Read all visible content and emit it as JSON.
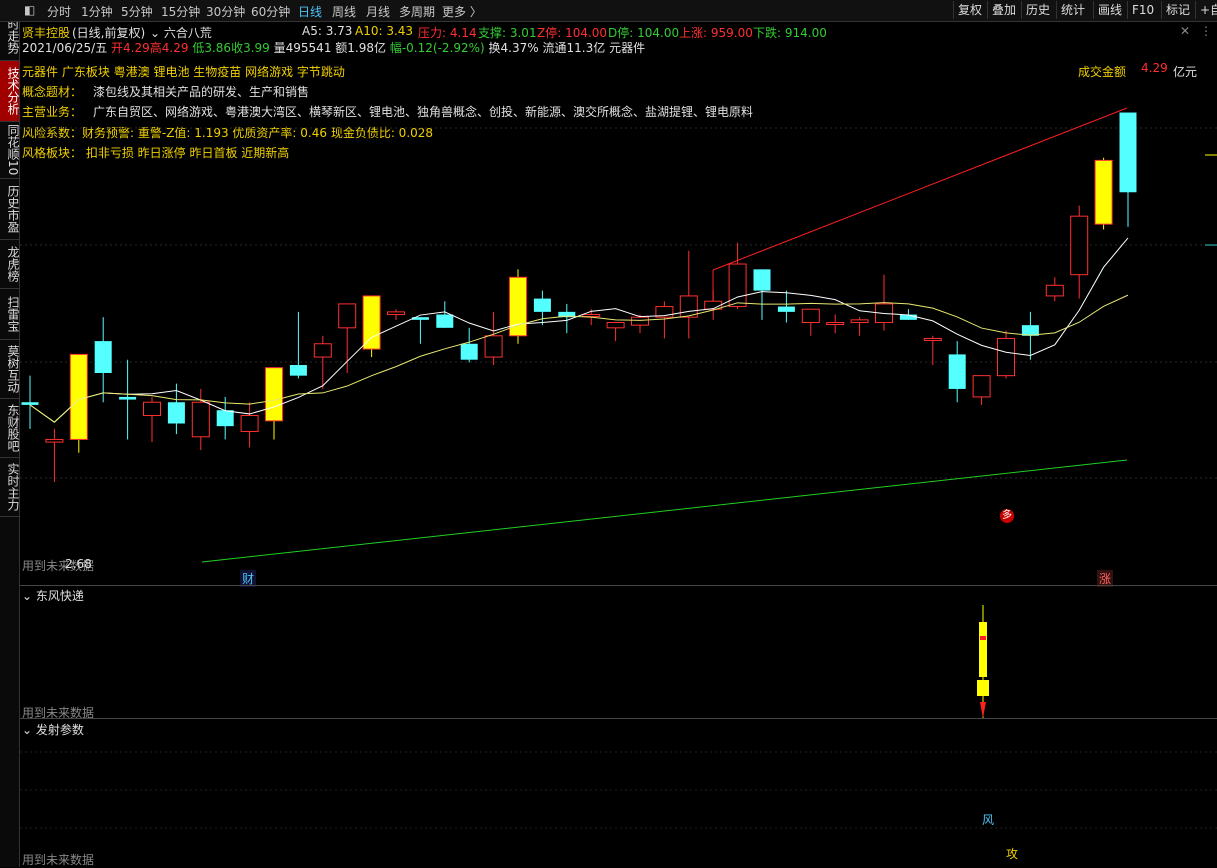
{
  "toolbar": {
    "periods": [
      "分时",
      "1分钟",
      "5分钟",
      "15分钟",
      "30分钟",
      "60分钟",
      "日线",
      "周线",
      "月线",
      "多周期",
      "更多 〉"
    ],
    "active_period": "日线",
    "right_buttons": [
      "复权",
      "叠加",
      "历史",
      "统计",
      "画线",
      "F10",
      "标记",
      "+自"
    ]
  },
  "side_tabs": [
    "分时走势",
    "技术分析",
    "同花顺10",
    "历史市盈",
    "龙虎榜",
    "扫雷宝",
    "莫树互动",
    "东财股吧",
    "实时主力"
  ],
  "active_side_tab": "技术分析",
  "header": {
    "stock_name": "贤丰控股",
    "mode": "(日线,前复权)",
    "indicator": "六合八荒",
    "a5": "A5: 3.73",
    "a10": "A10: 3.43",
    "pressure": "压力: 4.14",
    "support": "支撑: 3.01",
    "z_stop": "Z停: 104.00",
    "d_stop": "D停: 104.00",
    "up": "上涨: 959.00",
    "down": "下跌: 914.00"
  },
  "quote": {
    "date": "2021/06/25/五",
    "open": "开4.29",
    "high": "高4.29",
    "low": "低3.86",
    "close": "收3.99",
    "volume": "量495541",
    "amount": "额1.98亿",
    "change": "幅-0.12(-2.92%)",
    "turnover": "换4.37%",
    "float": "流通11.3亿",
    "sector": "元器件"
  },
  "info": {
    "tags": "元器件 广东板块 粤港澳 锂电池 生物疫苗 网络游戏 字节跳动",
    "concept_label": "概念题材：",
    "concept_value": "漆包线及其相关产品的研发、生产和销售",
    "business_label": "主营业务：",
    "business_value": "广东自贸区、网络游戏、粤港澳大湾区、横琴新区、锂电池、独角兽概念、创投、新能源、澳交所概念、盐湖提锂、锂电原料",
    "risk": "风险系数：财务预警: 重警-Z值: 1.193 优质资产率: 0.46 现金负债比: 0.028",
    "style": "风格板块：  扣非亏损 昨日涨停 昨日首板 近期新高"
  },
  "annotations": {
    "turnover_label": "成交金额",
    "turnover_value": "4.29",
    "turnover_unit": "亿元",
    "price_label_left": "2.68",
    "future_data": "用到未来数据",
    "marker_cai": "财",
    "marker_zhang": "涨",
    "marker_duo": "多",
    "marker_feng": "风",
    "marker_gong": "攻"
  },
  "panels": {
    "panel2_title": "东风快递",
    "panel3_title": "发射参数",
    "collapse_icon": "chevron-down-icon"
  },
  "colors": {
    "bg": "#000000",
    "up_candle": "#ff3030",
    "down_candle": "#54ffff",
    "limit_up": "#ffff00",
    "ma5": "#ffffff",
    "ma10": "#e8e870",
    "resistance": "#ff2020",
    "support": "#20d020"
  },
  "chart_data": {
    "type": "candlestick",
    "title": "贤丰控股 (日线,前复权)",
    "ylim": [
      2.55,
      4.45
    ],
    "candles": [
      {
        "o": 3.2,
        "h": 3.3,
        "l": 3.1,
        "c": 3.19,
        "limit": false
      },
      {
        "o": 3.05,
        "h": 3.1,
        "l": 2.9,
        "c": 3.06,
        "limit": false
      },
      {
        "o": 3.06,
        "h": 3.38,
        "l": 3.01,
        "c": 3.38,
        "limit": true
      },
      {
        "o": 3.43,
        "h": 3.52,
        "l": 3.2,
        "c": 3.31,
        "limit": false
      },
      {
        "o": 3.22,
        "h": 3.36,
        "l": 3.06,
        "c": 3.21,
        "limit": false
      },
      {
        "o": 3.15,
        "h": 3.22,
        "l": 3.05,
        "c": 3.2,
        "limit": false
      },
      {
        "o": 3.2,
        "h": 3.27,
        "l": 3.08,
        "c": 3.12,
        "limit": false
      },
      {
        "o": 3.07,
        "h": 3.25,
        "l": 3.02,
        "c": 3.2,
        "limit": false
      },
      {
        "o": 3.17,
        "h": 3.22,
        "l": 3.06,
        "c": 3.11,
        "limit": false
      },
      {
        "o": 3.09,
        "h": 3.2,
        "l": 3.03,
        "c": 3.15,
        "limit": false
      },
      {
        "o": 3.13,
        "h": 3.33,
        "l": 3.06,
        "c": 3.33,
        "limit": true
      },
      {
        "o": 3.34,
        "h": 3.54,
        "l": 3.29,
        "c": 3.3,
        "limit": false
      },
      {
        "o": 3.37,
        "h": 3.45,
        "l": 3.25,
        "c": 3.42,
        "limit": false
      },
      {
        "o": 3.48,
        "h": 3.51,
        "l": 3.31,
        "c": 3.57,
        "limit": false
      },
      {
        "o": 3.4,
        "h": 3.55,
        "l": 3.37,
        "c": 3.6,
        "limit": true
      },
      {
        "o": 3.53,
        "h": 3.55,
        "l": 3.51,
        "c": 3.54,
        "limit": false
      },
      {
        "o": 3.52,
        "h": 3.5,
        "l": 3.42,
        "c": 3.51,
        "limit": false
      },
      {
        "o": 3.53,
        "h": 3.58,
        "l": 3.49,
        "c": 3.48,
        "limit": false
      },
      {
        "o": 3.42,
        "h": 3.48,
        "l": 3.35,
        "c": 3.36,
        "limit": false
      },
      {
        "o": 3.37,
        "h": 3.54,
        "l": 3.34,
        "c": 3.45,
        "limit": false
      },
      {
        "o": 3.45,
        "h": 3.7,
        "l": 3.42,
        "c": 3.67,
        "limit": true
      },
      {
        "o": 3.59,
        "h": 3.62,
        "l": 3.49,
        "c": 3.54,
        "limit": false
      },
      {
        "o": 3.54,
        "h": 3.57,
        "l": 3.46,
        "c": 3.52,
        "limit": false
      },
      {
        "o": 3.53,
        "h": 3.55,
        "l": 3.49,
        "c": 3.53,
        "limit": false
      },
      {
        "o": 3.48,
        "h": 3.5,
        "l": 3.43,
        "c": 3.5,
        "limit": false
      },
      {
        "o": 3.49,
        "h": 3.53,
        "l": 3.46,
        "c": 3.52,
        "limit": false
      },
      {
        "o": 3.52,
        "h": 3.58,
        "l": 3.44,
        "c": 3.56,
        "limit": false
      },
      {
        "o": 3.52,
        "h": 3.77,
        "l": 3.44,
        "c": 3.6,
        "limit": false
      },
      {
        "o": 3.55,
        "h": 3.62,
        "l": 3.51,
        "c": 3.58,
        "limit": false
      },
      {
        "o": 3.56,
        "h": 3.8,
        "l": 3.55,
        "c": 3.72,
        "limit": false
      },
      {
        "o": 3.7,
        "h": 3.67,
        "l": 3.51,
        "c": 3.62,
        "limit": false
      },
      {
        "o": 3.56,
        "h": 3.62,
        "l": 3.5,
        "c": 3.54,
        "limit": false
      },
      {
        "o": 3.5,
        "h": 3.54,
        "l": 3.45,
        "c": 3.55,
        "limit": false
      },
      {
        "o": 3.5,
        "h": 3.53,
        "l": 3.46,
        "c": 3.5,
        "limit": false
      },
      {
        "o": 3.5,
        "h": 3.52,
        "l": 3.45,
        "c": 3.51,
        "limit": false
      },
      {
        "o": 3.5,
        "h": 3.68,
        "l": 3.47,
        "c": 3.57,
        "limit": false
      },
      {
        "o": 3.53,
        "h": 3.55,
        "l": 3.51,
        "c": 3.51,
        "limit": false
      },
      {
        "o": 3.44,
        "h": 3.45,
        "l": 3.34,
        "c": 3.44,
        "limit": false
      },
      {
        "o": 3.38,
        "h": 3.43,
        "l": 3.2,
        "c": 3.25,
        "limit": false
      },
      {
        "o": 3.22,
        "h": 3.3,
        "l": 3.19,
        "c": 3.3,
        "limit": false
      },
      {
        "o": 3.3,
        "h": 3.47,
        "l": 3.29,
        "c": 3.44,
        "limit": false
      },
      {
        "o": 3.49,
        "h": 3.54,
        "l": 3.36,
        "c": 3.45,
        "limit": false
      },
      {
        "o": 3.6,
        "h": 3.67,
        "l": 3.58,
        "c": 3.64,
        "limit": false
      },
      {
        "o": 3.68,
        "h": 3.94,
        "l": 3.59,
        "c": 3.9,
        "limit": false
      },
      {
        "o": 3.87,
        "h": 4.12,
        "l": 3.85,
        "c": 4.11,
        "limit": true
      },
      {
        "o": 4.29,
        "h": 4.29,
        "l": 3.86,
        "c": 3.99,
        "limit": false
      }
    ],
    "ma5_label": "A5",
    "ma10_label": "A10"
  }
}
